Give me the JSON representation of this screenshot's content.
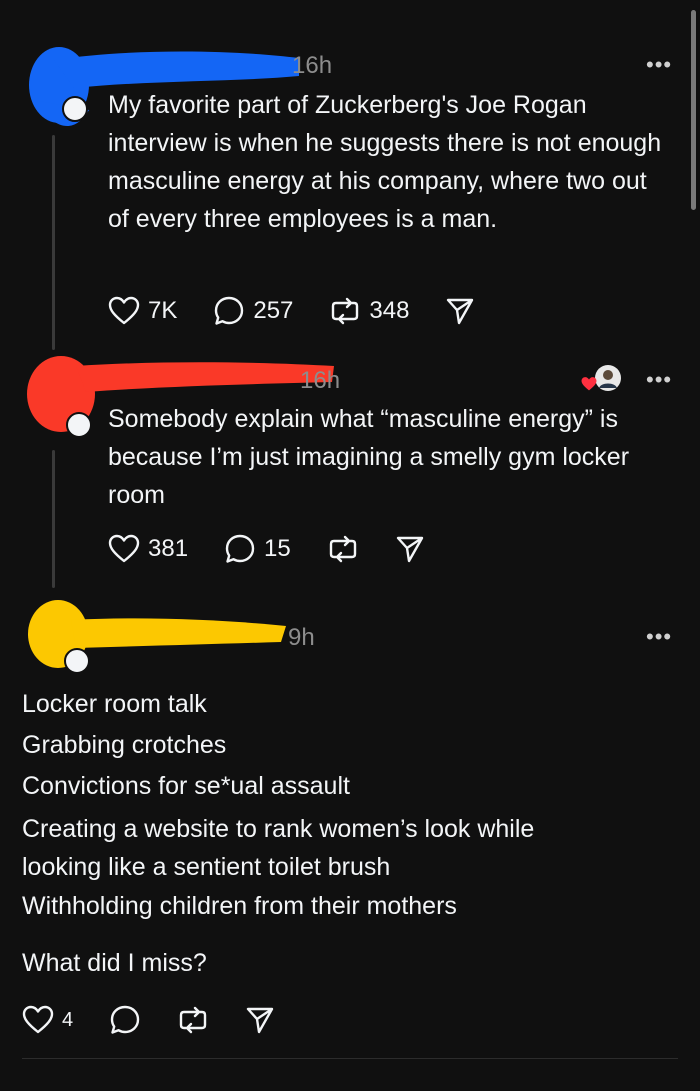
{
  "colors": {
    "background": "#101010",
    "text": "#f3f5f7",
    "muted": "#8d8d8d",
    "redact_blue": "#1466f5",
    "redact_red": "#fa3928",
    "redact_yellow": "#fcc801",
    "like_red": "#ff3040"
  },
  "posts": [
    {
      "time": "16h",
      "more": "•••",
      "text": "My favorite part of Zuckerberg's Joe Rogan interview is when he suggests there is not enough masculine energy at his company, where two out of every three employees is a man.",
      "likes": "7K",
      "replies": "257",
      "reposts": "348"
    },
    {
      "time": "16h",
      "more": "•••",
      "text": "Somebody explain what “masculine energy” is because I’m just imagining a smelly gym locker room",
      "likes": "381",
      "replies": "15"
    },
    {
      "time": "9h",
      "more": "•••",
      "lines": [
        "Locker room talk",
        "Grabbing crotches",
        "Convictions for se*ual assault",
        "Creating a website to rank women’s look while",
        "looking like a sentient toilet brush",
        "Withholding children from their mothers"
      ],
      "closing": "What did I miss?",
      "likes": "4"
    }
  ],
  "icons": {
    "like": "heart-icon",
    "reply": "comment-icon",
    "repost": "repost-icon",
    "share": "send-icon",
    "more": "more-icon"
  }
}
